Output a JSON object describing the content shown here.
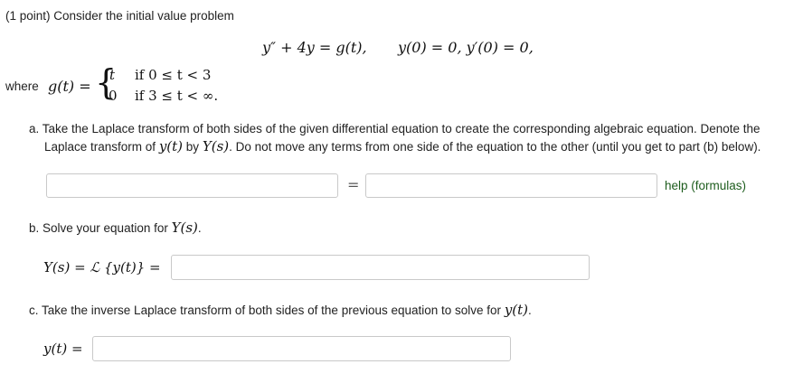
{
  "problem": {
    "intro": "(1 point) Consider the initial value problem",
    "ode": "y″ + 4y = g(t),",
    "initial_conditions": "y(0) = 0,   y′(0) = 0,",
    "where_label": "where",
    "g_lhs": "g(t) =",
    "piece1_value": "t",
    "piece1_condition": "if 0 ≤ t < 3",
    "piece2_value": "0",
    "piece2_condition": "if 3 ≤ t < ∞."
  },
  "part_a": {
    "text_line1": "a. Take the Laplace transform of both sides of the given differential equation to create the corresponding algebraic equation. Denote the",
    "text_line2_pre": "Laplace transform of ",
    "text_line2_y": "y(t)",
    "text_line2_mid": " by ",
    "text_line2_Y": "Y(s)",
    "text_line2_post": ". Do not move any terms from one side of the equation to the other (until you get to part (b) below).",
    "equals": "=",
    "left_value": "",
    "right_value": "",
    "help_link": "help (formulas)"
  },
  "part_b": {
    "text_pre": "b. Solve your equation for ",
    "text_Y": "Y(s)",
    "text_post": ".",
    "lhs": "Y(s) = ℒ {y(t)} =",
    "value": ""
  },
  "part_c": {
    "text_pre": "c. Take the inverse Laplace transform of both sides of the previous equation to solve for ",
    "text_y": "y(t)",
    "text_post": ".",
    "lhs": "y(t) =",
    "value": ""
  }
}
